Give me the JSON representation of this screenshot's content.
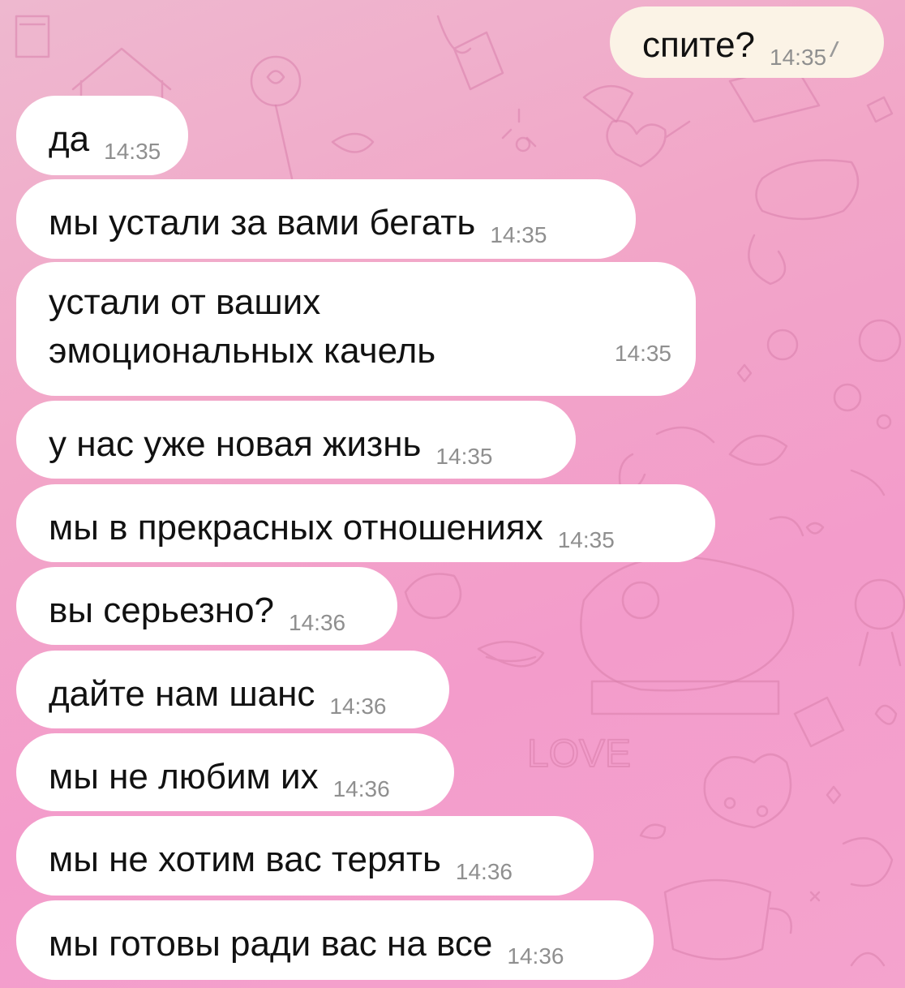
{
  "messages": [
    {
      "id": "m1",
      "direction": "outgoing",
      "text": "спите?",
      "time": "14:35",
      "status_icon": "double-check-read"
    },
    {
      "id": "m2",
      "direction": "incoming",
      "text": "да",
      "time": "14:35"
    },
    {
      "id": "m3",
      "direction": "incoming",
      "text": "мы устали за вами бегать",
      "time": "14:35"
    },
    {
      "id": "m4",
      "direction": "incoming",
      "text": "устали от ваших эмоциональных качель",
      "time": "14:35"
    },
    {
      "id": "m5",
      "direction": "incoming",
      "text": "у нас уже новая жизнь",
      "time": "14:35"
    },
    {
      "id": "m6",
      "direction": "incoming",
      "text": "мы в прекрасных отношениях",
      "time": "14:35"
    },
    {
      "id": "m7",
      "direction": "incoming",
      "text": "вы серьезно?",
      "time": "14:36"
    },
    {
      "id": "m8",
      "direction": "incoming",
      "text": "дайте нам шанс",
      "time": "14:36"
    },
    {
      "id": "m9",
      "direction": "incoming",
      "text": "мы не любим их",
      "time": "14:36"
    },
    {
      "id": "m10",
      "direction": "incoming",
      "text": "мы не хотим вас терять",
      "time": "14:36"
    },
    {
      "id": "m11",
      "direction": "incoming",
      "text": "мы готовы ради вас на все",
      "time": "14:36"
    }
  ],
  "background": {
    "colors": {
      "start": "#eeb8cf",
      "end": "#f4a3cd",
      "doodle": "#d97fab"
    },
    "doodle_text": "LOVE"
  },
  "colors": {
    "incoming_bubble": "#ffffff",
    "outgoing_bubble": "#fbf3e6",
    "timestamp": "#8f8f8f"
  }
}
